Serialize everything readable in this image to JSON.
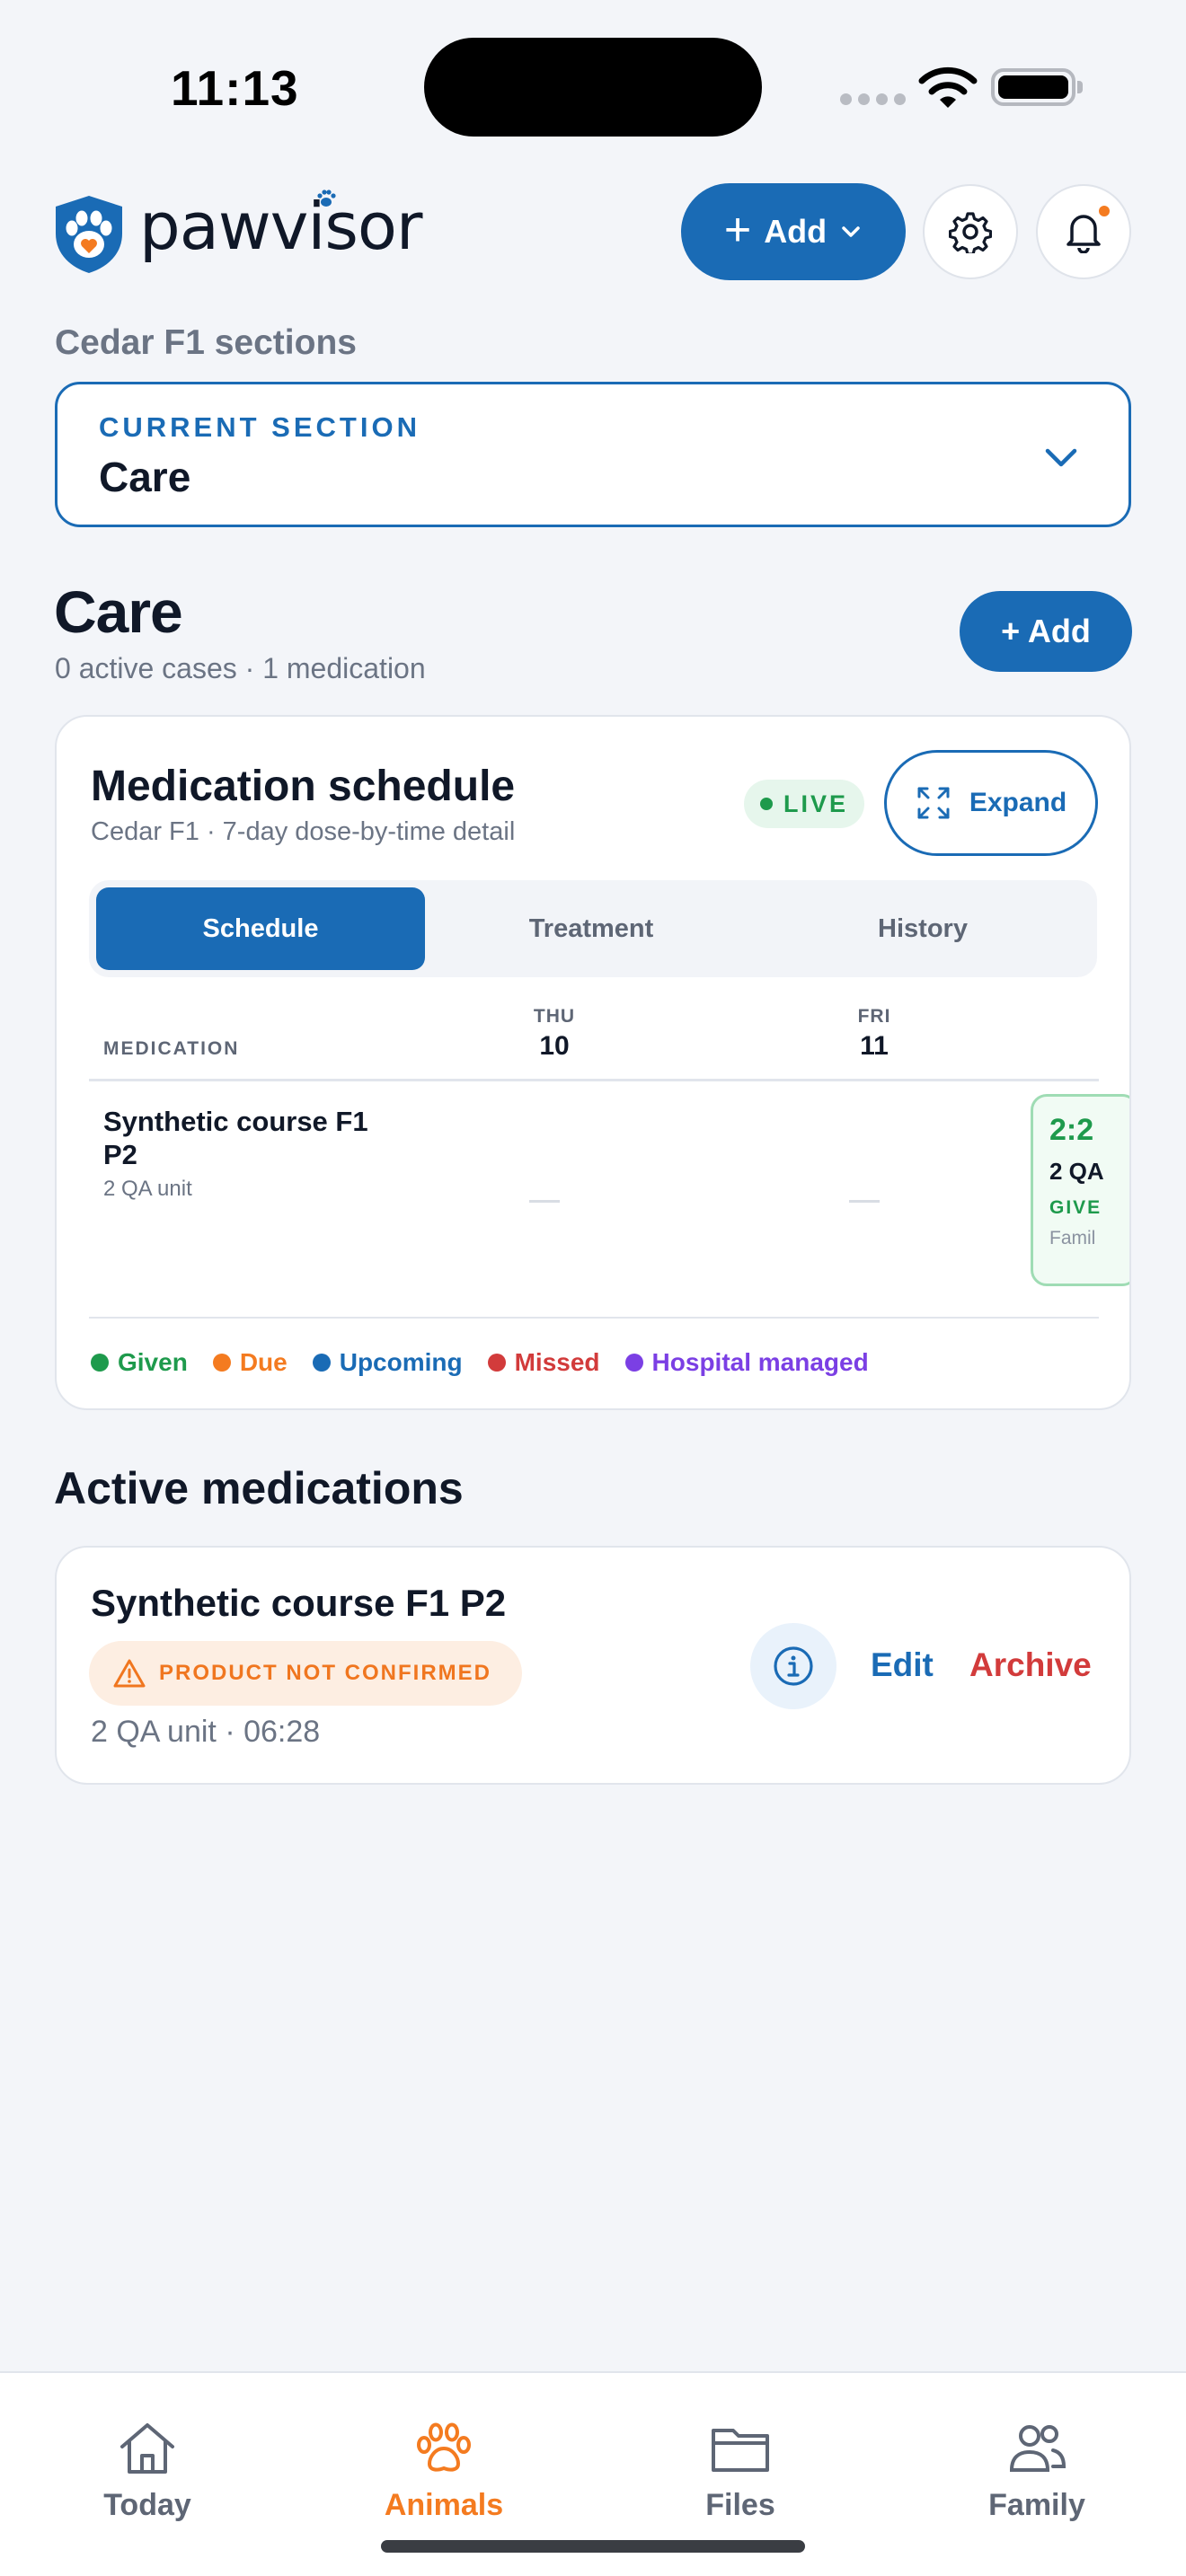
{
  "status_bar": {
    "time": "11:13"
  },
  "header": {
    "logo_text": "pawvisor",
    "add_button_label": "Add"
  },
  "section_selector": {
    "group_label": "Cedar F1 sections",
    "eyebrow": "CURRENT SECTION",
    "value": "Care"
  },
  "care": {
    "title": "Care",
    "subtitle": "0 active cases · 1 medication",
    "add_button_label": "+ Add"
  },
  "schedule_card": {
    "title": "Medication schedule",
    "subtitle": "Cedar F1 · 7-day dose-by-time detail",
    "live_label": "LIVE",
    "expand_label": "Expand",
    "tabs": [
      {
        "label": "Schedule",
        "active": true
      },
      {
        "label": "Treatment",
        "active": false
      },
      {
        "label": "History",
        "active": false
      }
    ],
    "medication_column_label": "MEDICATION",
    "days": [
      {
        "dow": "THU",
        "num": "10"
      },
      {
        "dow": "FRI",
        "num": "11"
      }
    ],
    "rows": [
      {
        "name": "Synthetic course F1 P2",
        "dose": "2 QA unit",
        "cells": [
          "—",
          "—"
        ],
        "dose_card": {
          "time": "2:2",
          "amount": "2 QA",
          "status": "GIVE",
          "by": "Famil"
        }
      }
    ],
    "legend": [
      {
        "label": "Given",
        "color": "#1e9a4c"
      },
      {
        "label": "Due",
        "color": "#f47b20"
      },
      {
        "label": "Upcoming",
        "color": "#1a6bb5"
      },
      {
        "label": "Missed",
        "color": "#d23b3b"
      },
      {
        "label": "Hospital managed",
        "color": "#7b3fe4"
      }
    ]
  },
  "active_medications": {
    "title": "Active medications",
    "items": [
      {
        "name": "Synthetic course F1 P2",
        "warning": "PRODUCT NOT CONFIRMED",
        "meta": "2 QA unit · 06:28",
        "edit_label": "Edit",
        "archive_label": "Archive"
      }
    ]
  },
  "tab_bar": {
    "items": [
      {
        "label": "Today",
        "icon": "home-icon",
        "active": false
      },
      {
        "label": "Animals",
        "icon": "paw-icon",
        "active": true
      },
      {
        "label": "Files",
        "icon": "folder-icon",
        "active": false
      },
      {
        "label": "Family",
        "icon": "people-icon",
        "active": false
      }
    ]
  },
  "colors": {
    "primary": "#1a6bb5",
    "accent": "#f47b20",
    "given": "#1e9a4c",
    "missed": "#d23b3b"
  }
}
